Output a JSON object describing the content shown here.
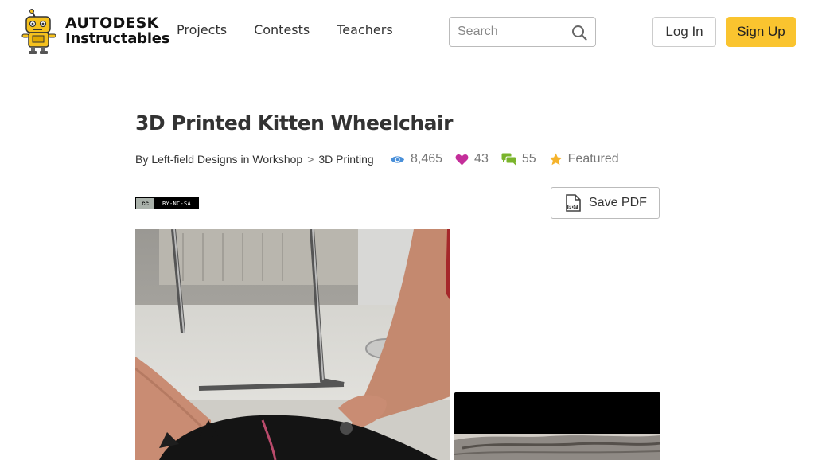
{
  "header": {
    "logo": {
      "line1": "AUTODESK",
      "line2": "Instructables"
    },
    "nav": [
      {
        "label": "Projects"
      },
      {
        "label": "Contests"
      },
      {
        "label": "Teachers"
      }
    ],
    "search": {
      "placeholder": "Search",
      "value": ""
    },
    "login_label": "Log In",
    "signup_label": "Sign Up"
  },
  "article": {
    "title": "3D Printed Kitten Wheelchair",
    "byline": {
      "by": "By",
      "author": "Left-field Designs",
      "in": "in",
      "category": "Workshop",
      "separator": ">",
      "subcategory": "3D Printing"
    },
    "stats": {
      "views": "8,465",
      "favorites": "43",
      "comments": "55",
      "featured": "Featured"
    },
    "license_left": "cc",
    "license_right": "BY-NC-SA",
    "save_pdf_label": "Save PDF"
  },
  "colors": {
    "accent_yellow": "#fac42f",
    "views_icon": "#4a90d9",
    "heart_icon": "#c42e9a",
    "comment_icon": "#7ab42b",
    "star_icon": "#f5b32b"
  },
  "icons": {
    "logo": "robot-mascot-icon",
    "search": "search-icon",
    "views": "eye-icon",
    "favorites": "heart-icon",
    "comments": "comment-bubbles-icon",
    "featured": "star-icon",
    "pdf": "pdf-file-icon"
  }
}
